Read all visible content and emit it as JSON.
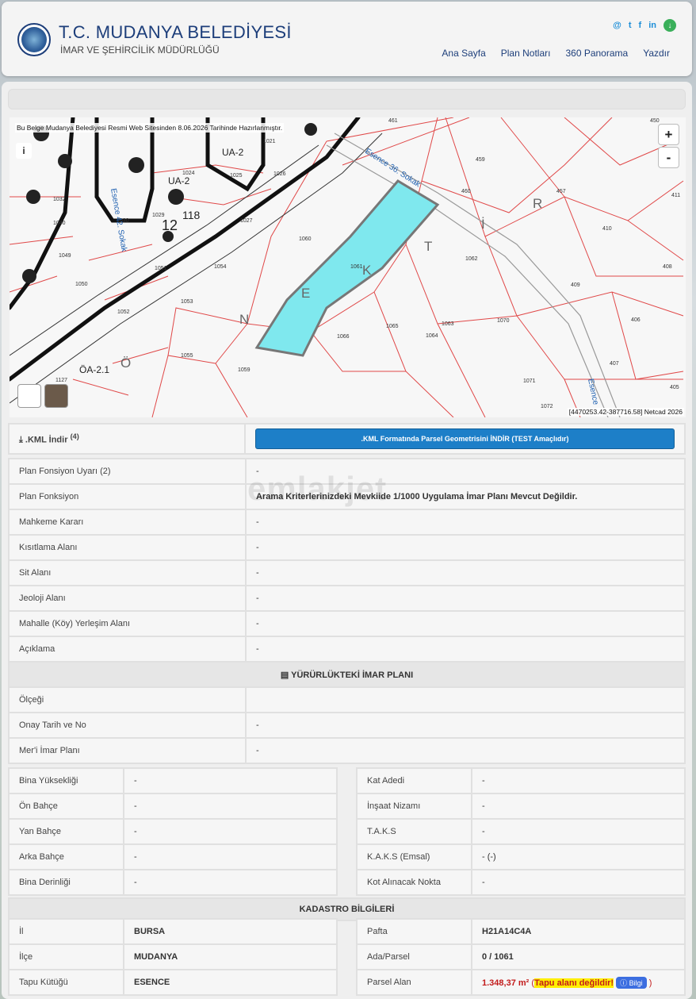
{
  "header": {
    "title": "T.C. MUDANYA BELEDİYESİ",
    "subtitle": "İMAR VE ŞEHİRCİLİK MÜDÜRLÜĞÜ",
    "nav": [
      "Ana Sayfa",
      "Plan Notları",
      "360 Panorama",
      "Yazdır"
    ],
    "socials": [
      "@",
      "t",
      "f",
      "in",
      "↓"
    ]
  },
  "map": {
    "note": "Bu Belge Mudanya Belediyesi Resmi Web Sitesinden 8.06.2026 Tarihinde Hazırlanmıştır.",
    "info_label": "i",
    "zoom_in": "+",
    "zoom_out": "-",
    "coords": "[4470253.42-387716.58] Netcad 2026",
    "parcel_labels": [
      "461",
      "450",
      "459",
      "460",
      "457",
      "411",
      "410",
      "408",
      "1060",
      "1062",
      "409",
      "406",
      "1061",
      "1065",
      "1063",
      "1064",
      "1070",
      "407",
      "1066",
      "405",
      "1059",
      "1071",
      "1072",
      "1021",
      "1024",
      "1025",
      "1026",
      "1027",
      "1029",
      "1030",
      "1032",
      "1040",
      "1049",
      "1050",
      "1051",
      "1052",
      "1053",
      "1054",
      "1055",
      "1127"
    ],
    "zone_labels": [
      "UA-2",
      "UA-2",
      "ÖA-2.1",
      "12",
      "118"
    ],
    "street_labels": [
      "Esence 36. Sokak",
      "Esence 42. Sokak",
      "Esence"
    ],
    "area_letters": [
      "N",
      "E",
      "K",
      "T",
      "İ",
      "R",
      "Ö"
    ],
    "highlight_color": "#7fe8ee"
  },
  "kml": {
    "label": ".KML İndir",
    "note": "(4)",
    "button": ".KML Formatında Parsel Geometrisini İNDİR (TEST Amaçlıdır)"
  },
  "plan_rows": [
    {
      "label": "Plan Fonsiyon Uyarı (2)",
      "value": "-"
    },
    {
      "label": "Plan Fonksiyon",
      "value": "Arama Kriterlerinizdeki Mevkiide 1/1000 Uygulama İmar Planı Mevcut Değildir."
    },
    {
      "label": "Mahkeme Kararı",
      "value": "-"
    },
    {
      "label": "Kısıtlama Alanı",
      "value": "-"
    },
    {
      "label": "Sit Alanı",
      "value": "-"
    },
    {
      "label": "Jeoloji Alanı",
      "value": "-"
    },
    {
      "label": "Mahalle (Köy) Yerleşim Alanı",
      "value": "-"
    },
    {
      "label": "Açıklama",
      "value": "-"
    }
  ],
  "imar": {
    "section_title": "YÜRÜRLÜKTEKİ İMAR PLANI",
    "rows": [
      {
        "label": "Ölçeği",
        "value": ""
      },
      {
        "label": "Onay Tarih ve No",
        "value": "-"
      },
      {
        "label": "Mer'i İmar Planı",
        "value": "-"
      }
    ]
  },
  "building": {
    "left": [
      {
        "label": "Bina Yüksekliği",
        "value": "-"
      },
      {
        "label": "Ön Bahçe",
        "value": "-"
      },
      {
        "label": "Yan Bahçe",
        "value": "-"
      },
      {
        "label": "Arka Bahçe",
        "value": "-"
      },
      {
        "label": "Bina Derinliği",
        "value": "-"
      }
    ],
    "right": [
      {
        "label": "Kat Adedi",
        "value": "-"
      },
      {
        "label": "İnşaat Nizamı",
        "value": "-"
      },
      {
        "label": "T.A.K.S",
        "value": "-"
      },
      {
        "label": "K.A.K.S (Emsal)",
        "value": "- (-)"
      },
      {
        "label": "Kot Alınacak Nokta",
        "value": "-"
      }
    ]
  },
  "kadastro": {
    "section_title": "KADASTRO BİLGİLERİ",
    "left": [
      {
        "label": "İl",
        "value": "BURSA"
      },
      {
        "label": "İlçe",
        "value": "MUDANYA"
      },
      {
        "label": "Tapu Kütüğü",
        "value": "ESENCE"
      }
    ],
    "right": [
      {
        "label": "Pafta",
        "value": "H21A14C4A"
      },
      {
        "label": "Ada/Parsel",
        "value": "0 / 1061"
      },
      {
        "label": "Parsel Alan",
        "value": "1.348,37 m²"
      }
    ],
    "area_warning": "Tapu alanı değildir!",
    "info_button": "Bilgi",
    "paren_open": "(",
    "paren_close": ")"
  },
  "watermark": "emlakjet"
}
